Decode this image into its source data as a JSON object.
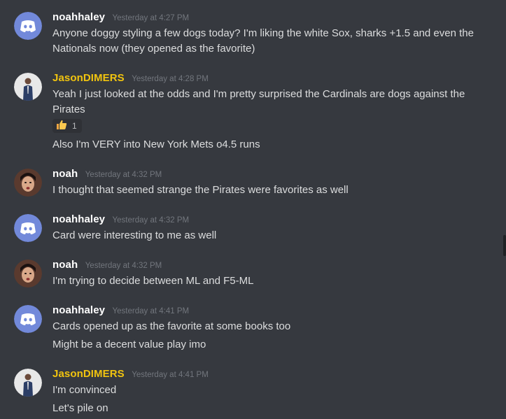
{
  "colors": {
    "background": "#36393f",
    "username_default": "#ffffff",
    "username_gold": "#f1c40f",
    "timestamp": "#72767d",
    "message_text": "#dcddde",
    "discord_avatar_blue": "#7289da"
  },
  "messages": [
    {
      "username": "noahhaley",
      "avatar": "discord-default-avatar-icon",
      "timestamp": "Yesterday at 4:27 PM",
      "lines": [
        "Anyone doggy styling a few dogs today? I'm liking the white Sox, sharks +1.5 and even the Nationals now (they opened as the favorite)"
      ]
    },
    {
      "username": "JasonDIMERS",
      "avatar": "user-photo-avatar",
      "timestamp": "Yesterday at 4:28 PM",
      "lines": [
        "Yeah I just looked at the odds and I'm pretty surprised the Cardinals are dogs against the Pirates",
        "Also I'm VERY into New York Mets o4.5 runs"
      ],
      "reaction": {
        "emoji": "thumbs-up-icon",
        "count": "1"
      }
    },
    {
      "username": "noah",
      "avatar": "user-photo-avatar",
      "timestamp": "Yesterday at 4:32 PM",
      "lines": [
        "I thought that seemed strange the Pirates were favorites as well"
      ]
    },
    {
      "username": "noahhaley",
      "avatar": "discord-default-avatar-icon",
      "timestamp": "Yesterday at 4:32 PM",
      "lines": [
        "Card were interesting to me as well"
      ]
    },
    {
      "username": "noah",
      "avatar": "user-photo-avatar",
      "timestamp": "Yesterday at 4:32 PM",
      "lines": [
        "I'm trying to decide between ML and F5-ML"
      ]
    },
    {
      "username": "noahhaley",
      "avatar": "discord-default-avatar-icon",
      "timestamp": "Yesterday at 4:41 PM",
      "lines": [
        "Cards opened up as the favorite at some books too",
        "Might be a decent value play imo"
      ]
    },
    {
      "username": "JasonDIMERS",
      "avatar": "user-photo-avatar",
      "timestamp": "Yesterday at 4:41 PM",
      "lines": [
        "I'm convinced",
        "Let's pile on"
      ]
    }
  ]
}
